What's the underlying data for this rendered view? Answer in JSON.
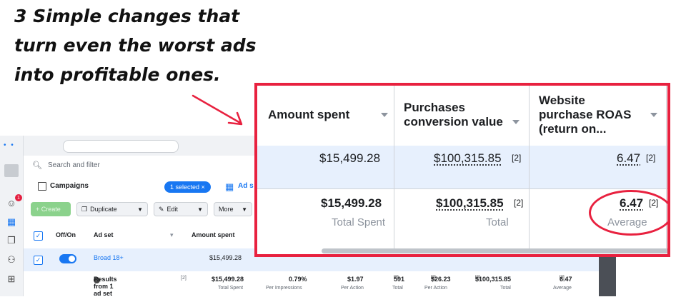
{
  "headline": {
    "lines": [
      "3 Simple changes that",
      "turn even the worst ads",
      "into profitable ones."
    ]
  },
  "colors": {
    "highlight": "#e8213f",
    "brand": "#1877f2",
    "selected_row": "#e7f0fd"
  },
  "ads_manager": {
    "search_placeholder": "Search and filter",
    "campaigns_label": "Campaigns",
    "selected_badge": "1 selected",
    "selected_badge_close": "×",
    "adset_tab": "Ad s",
    "notification_count": "1",
    "toolbar": {
      "create": "+ Create",
      "duplicate": "Duplicate",
      "edit": "Edit",
      "more": "More"
    },
    "table": {
      "headers": {
        "off_on": "Off/On",
        "ad_set": "Ad set",
        "amount_spent": "Amount spent"
      },
      "row": {
        "name": "Broad 18+",
        "amount_spent": "$15,499.28"
      },
      "results": {
        "label": "Results from 1 ad set",
        "info_icon": "i",
        "ref": "[2]",
        "amount_spent": "$15,499.28",
        "amount_spent_sub": "Total Spent",
        "ctr": "0.79%",
        "ctr_sub": "Per Impressions",
        "cpa": "$1.97",
        "cpa_sub": "Per Action",
        "purchases": "591",
        "purchases_ref": "[2]",
        "purchases_sub": "Total",
        "cost_per_purchase": "$26.23",
        "cost_per_purchase_ref": "[2]",
        "cost_per_purchase_sub": "Per Action",
        "conv_value": "$100,315.85",
        "conv_value_ref": "[2]",
        "conv_value_sub": "Total",
        "roas": "6.47",
        "roas_ref": "[2]",
        "roas_sub": "Average"
      }
    }
  },
  "zoom": {
    "headers": {
      "amount_spent": "Amount spent",
      "conv_value_line1": "Purchases",
      "conv_value_line2": "conversion value",
      "roas_line1": "Website",
      "roas_line2": "purchase ROAS",
      "roas_line3": "(return on..."
    },
    "row": {
      "amount_spent": "$15,499.28",
      "conv_value": "$100,315.85",
      "conv_value_ref": "[2]",
      "roas": "6.47",
      "roas_ref": "[2]"
    },
    "totals": {
      "amount_spent": "$15,499.28",
      "amount_spent_sub": "Total Spent",
      "conv_value": "$100,315.85",
      "conv_value_ref": "[2]",
      "conv_value_sub": "Total",
      "roas": "6.47",
      "roas_ref": "[2]",
      "roas_sub": "Average"
    }
  }
}
